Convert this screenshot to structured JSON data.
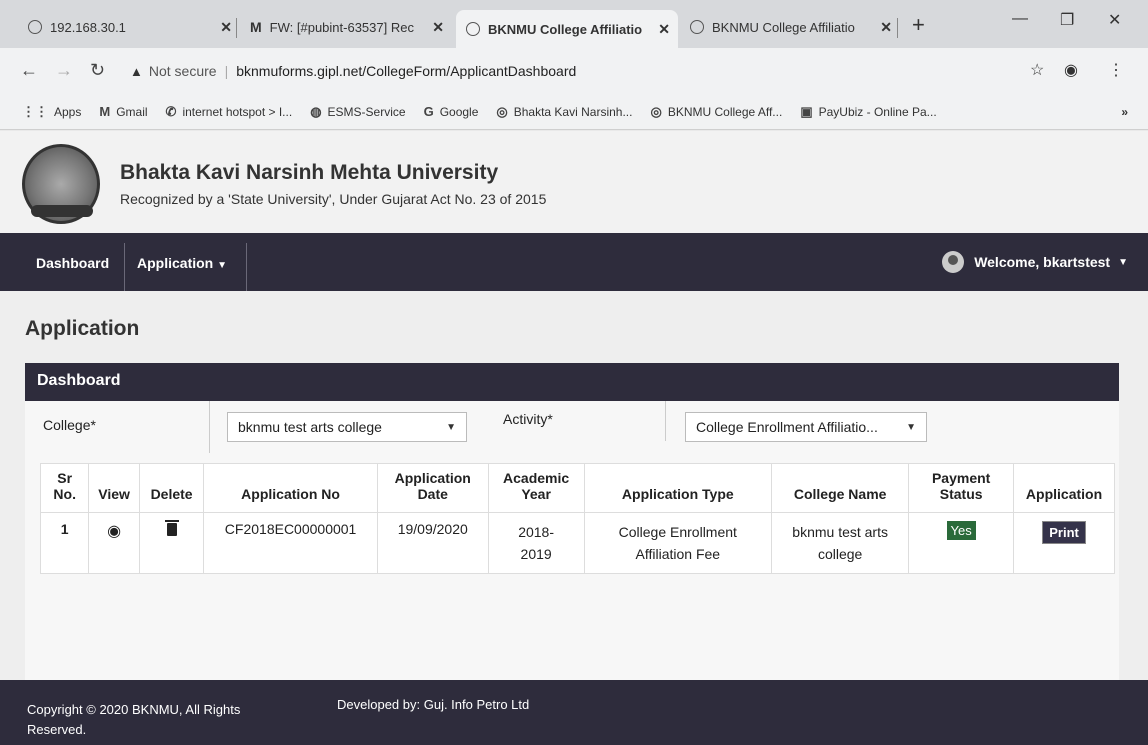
{
  "browser": {
    "tabs": [
      {
        "title": "192.168.30.1",
        "icon": "globe-icon"
      },
      {
        "title": "FW: [#pubint-63537] Rec",
        "icon": "gmail-icon"
      },
      {
        "title": "BKNMU College Affiliatio",
        "icon": "university-icon",
        "active": true
      },
      {
        "title": "BKNMU College Affiliatio",
        "icon": "university-icon"
      }
    ],
    "new_tab": "+",
    "address": {
      "security": "Not secure",
      "url": "bknmuforms.gipl.net/CollegeForm/ApplicantDashboard"
    },
    "bookmarks": [
      {
        "label": "Apps",
        "icon": "apps-icon"
      },
      {
        "label": "Gmail",
        "icon": "gmail-icon"
      },
      {
        "label": "internet hotspot > I...",
        "icon": "phone-icon"
      },
      {
        "label": "ESMS-Service",
        "icon": "globe-icon"
      },
      {
        "label": "Google",
        "icon": "google-icon"
      },
      {
        "label": "Bhakta Kavi Narsinh...",
        "icon": "university-icon"
      },
      {
        "label": "BKNMU College Aff...",
        "icon": "university-icon"
      },
      {
        "label": "PayUbiz - Online Pa...",
        "icon": "payu-icon"
      }
    ]
  },
  "header": {
    "university_name": "Bhakta Kavi Narsinh Mehta University",
    "subtitle": "Recognized by a 'State University', Under Gujarat Act No. 23 of 2015"
  },
  "navbar": {
    "dashboard": "Dashboard",
    "application": "Application",
    "welcome": "Welcome, bkartstest"
  },
  "page_title": "Application",
  "panel": {
    "title": "Dashboard",
    "college_label": "College*",
    "college_value": "bknmu test arts college",
    "activity_label": "Activity*",
    "activity_value": "College Enrollment Affiliatio..."
  },
  "table": {
    "headers": {
      "sr": "Sr No.",
      "view": "View",
      "delete": "Delete",
      "app_no": "Application No",
      "app_date": "Application Date",
      "year": "Academic Year",
      "type": "Application Type",
      "college": "College Name",
      "payment": "Payment Status",
      "application": "Application"
    },
    "rows": [
      {
        "sr": "1",
        "app_no": "CF2018EC00000001",
        "app_date": "19/09/2020",
        "year": "2018-2019",
        "type": "College Enrollment Affiliation Fee",
        "college": "bknmu test arts college",
        "payment": "Yes",
        "print": "Print"
      }
    ]
  },
  "footer": {
    "copyright": "Copyright © 2020 BKNMU, All Rights Reserved.",
    "developer": "Developed by: Guj. Info Petro Ltd"
  }
}
